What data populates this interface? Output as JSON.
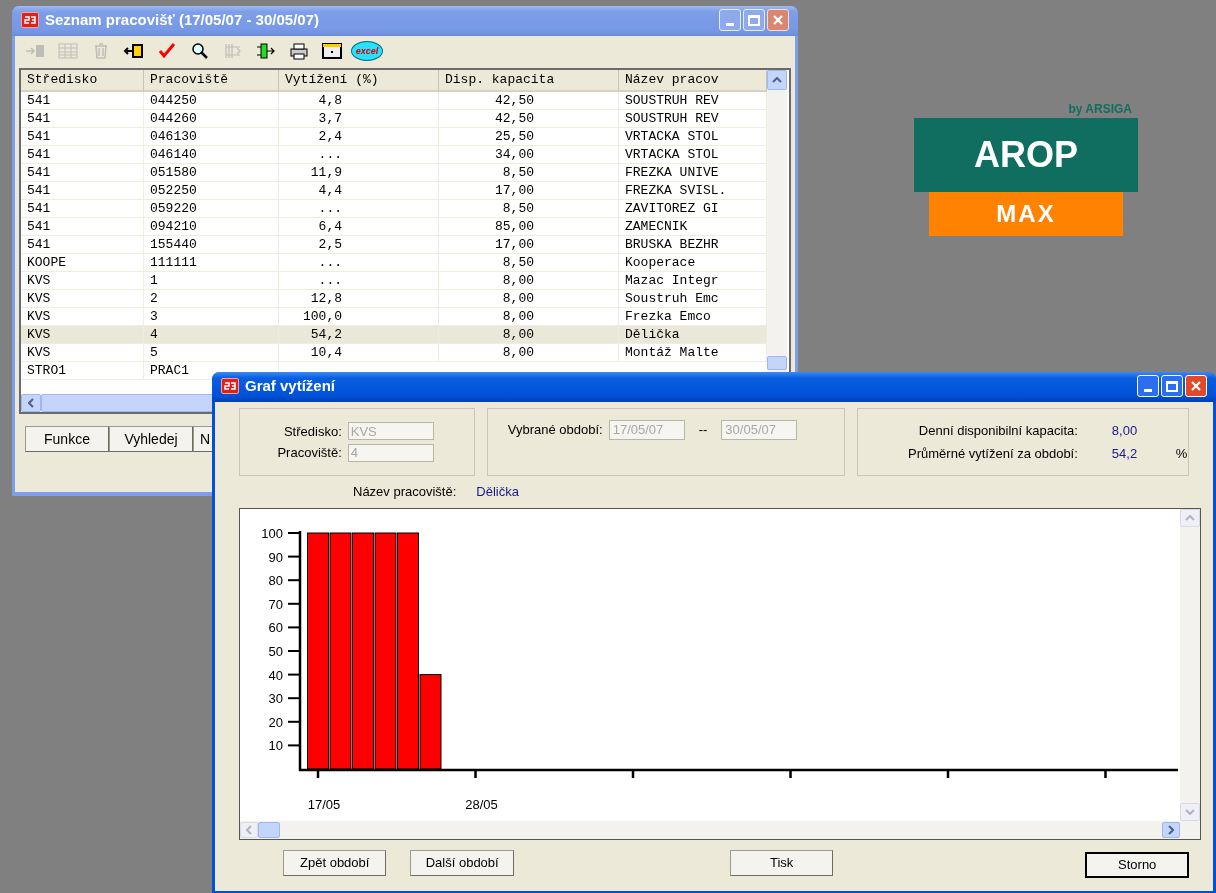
{
  "list_window": {
    "title": "Seznam pracovišť (17/05/07 - 30/05/07)",
    "active": false,
    "toolbar": [
      {
        "disabled": true
      },
      {
        "disabled": true
      },
      {
        "disabled": true
      },
      {
        "disabled": false
      },
      {
        "disabled": false
      },
      {
        "disabled": false
      },
      {
        "disabled": true
      },
      {
        "disabled": false
      },
      {
        "disabled": false
      },
      {
        "disabled": false
      },
      {
        "disabled": false,
        "label": "excel"
      }
    ],
    "table": {
      "columns": [
        "Středisko",
        "Pracoviště",
        "Vytížení (%)",
        "Disp. kapacita",
        "Název pracov"
      ],
      "rows": [
        {
          "cells": [
            "541",
            "044250",
            "4,8",
            "42,50",
            "SOUSTRUH REV"
          ],
          "selected": false
        },
        {
          "cells": [
            "541",
            "044260",
            "3,7",
            "42,50",
            "SOUSTRUH REV"
          ],
          "selected": false
        },
        {
          "cells": [
            "541",
            "046130",
            "2,4",
            "25,50",
            "VRTACKA STOL"
          ],
          "selected": false
        },
        {
          "cells": [
            "541",
            "046140",
            "...",
            "34,00",
            "VRTACKA STOL"
          ],
          "selected": false
        },
        {
          "cells": [
            "541",
            "051580",
            "11,9",
            "8,50",
            "FREZKA UNIVE"
          ],
          "selected": false
        },
        {
          "cells": [
            "541",
            "052250",
            "4,4",
            "17,00",
            "FREZKA SVISL."
          ],
          "selected": false
        },
        {
          "cells": [
            "541",
            "059220",
            "...",
            "8,50",
            "ZAVITOREZ GI"
          ],
          "selected": false
        },
        {
          "cells": [
            "541",
            "094210",
            "6,4",
            "85,00",
            "ZAMECNIK"
          ],
          "selected": false
        },
        {
          "cells": [
            "541",
            "155440",
            "2,5",
            "17,00",
            "BRUSKA BEZHR"
          ],
          "selected": false
        },
        {
          "cells": [
            "KOOPE",
            "111111",
            "...",
            "8,50",
            "Kooperace"
          ],
          "selected": false
        },
        {
          "cells": [
            "KVS",
            "1",
            "...",
            "8,00",
            "Mazac Integr"
          ],
          "selected": false
        },
        {
          "cells": [
            "KVS",
            "2",
            "12,8",
            "8,00",
            "Soustruh Emc"
          ],
          "selected": false
        },
        {
          "cells": [
            "KVS",
            "3",
            "100,0",
            "8,00",
            "Frezka Emco"
          ],
          "selected": false
        },
        {
          "cells": [
            "KVS",
            "4",
            "54,2",
            "8,00",
            "Dělička"
          ],
          "selected": true
        },
        {
          "cells": [
            "KVS",
            "5",
            "10,4",
            "8,00",
            "Montáž Malte"
          ],
          "selected": false
        },
        {
          "cells": [
            "STRO1",
            "PRAC1"
          ],
          "selected": false
        }
      ]
    },
    "buttons": [
      "Funkce",
      "Vyhledej",
      "N"
    ]
  },
  "logo": {
    "byline": "by ARSIGA",
    "name": "AROP",
    "edition": "MAX"
  },
  "chart_window": {
    "title": "Graf vytížení",
    "active": true,
    "center": {
      "label": "Středisko:",
      "value": "KVS",
      "disabled": true
    },
    "workplace": {
      "label": "Pracoviště:",
      "value": "4",
      "disabled": true
    },
    "period": {
      "label": "Vybrané období:",
      "from": "17/05/07",
      "separator": "--",
      "to": "30/05/07",
      "disabled": true
    },
    "stats": [
      {
        "label": "Denní disponibilní kapacita:",
        "value": "8,00"
      },
      {
        "label": "Průměrné vytížení za období:",
        "value": "54,2",
        "unit": "%"
      }
    ],
    "name_label": "Název pracoviště:",
    "name_value": "Dělička",
    "chart_data": {
      "type": "bar",
      "categories": [
        "17/05",
        null,
        null,
        null,
        null,
        null,
        null,
        "28/05"
      ],
      "series": [
        {
          "color": "#ff0000",
          "values": [
            100,
            100,
            100,
            100,
            100,
            40,
            null,
            null
          ]
        }
      ],
      "ylim": [
        0,
        100
      ],
      "yticks": [
        10,
        20,
        30,
        40,
        50,
        60,
        70,
        80,
        90,
        100
      ]
    },
    "buttons": [
      {
        "label": "Zpět období",
        "default": false
      },
      {
        "label": "Další období",
        "default": false
      },
      {
        "label": "Tisk",
        "default": false
      },
      {
        "label": "Storno",
        "default": true
      }
    ]
  }
}
